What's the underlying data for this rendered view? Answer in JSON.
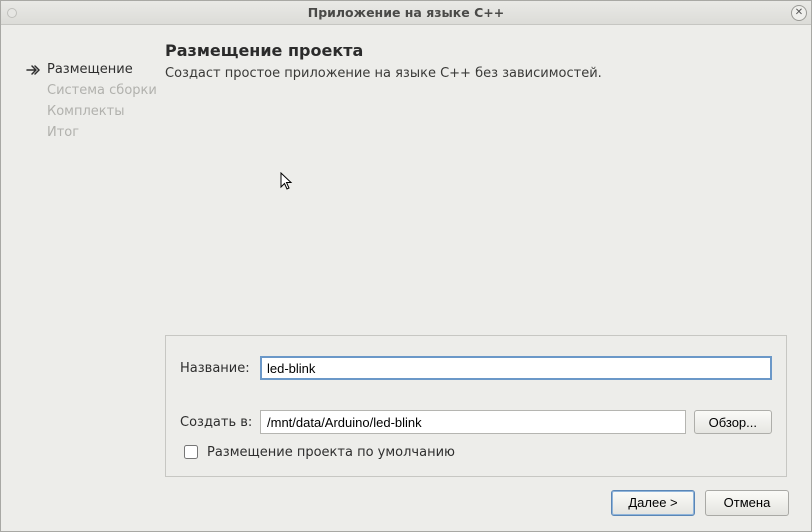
{
  "window": {
    "title": "Приложение на языке C++"
  },
  "sidebar": {
    "steps": [
      {
        "label": "Размещение",
        "active": true
      },
      {
        "label": "Система сборки",
        "active": false
      },
      {
        "label": "Комплекты",
        "active": false
      },
      {
        "label": "Итог",
        "active": false
      }
    ]
  },
  "main": {
    "heading": "Размещение проекта",
    "subheading": "Создаст простое приложение на языке C++ без зависимостей."
  },
  "form": {
    "name_label": "Название:",
    "name_value": "led-blink",
    "path_label": "Создать в:",
    "path_value": "/mnt/data/Arduino/led-blink",
    "browse_label": "Обзор...",
    "default_location_label": "Размещение проекта по умолчанию",
    "default_location_checked": false
  },
  "buttons": {
    "next": "Далее >",
    "cancel": "Отмена"
  }
}
